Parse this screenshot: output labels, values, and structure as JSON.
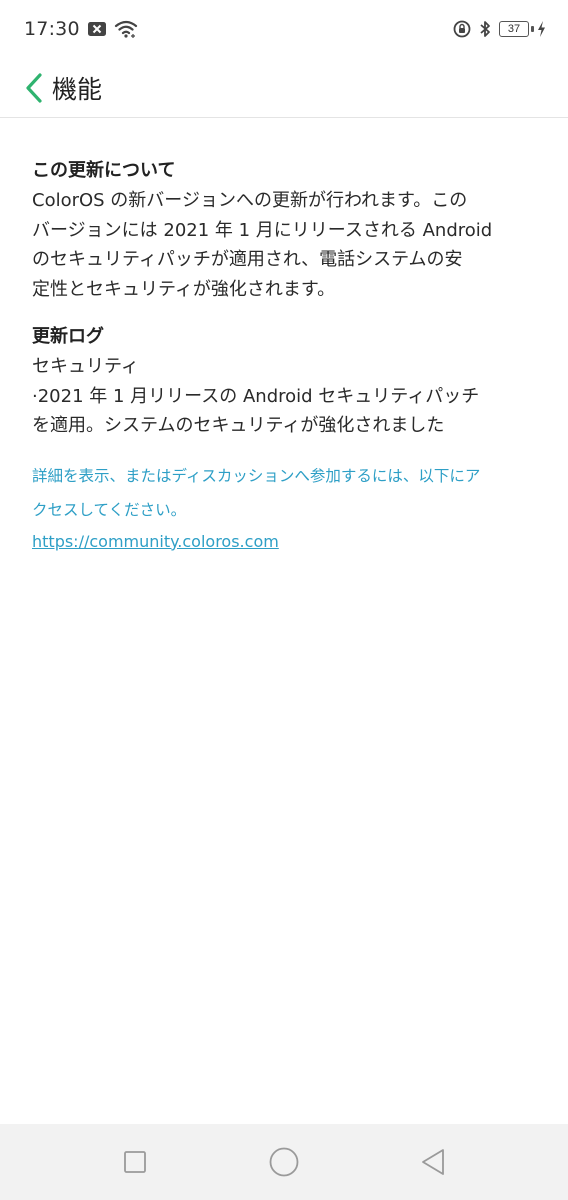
{
  "status_bar": {
    "time": "17:30",
    "battery_level": "37",
    "icons_left": [
      "notification-x-icon",
      "wifi-icon"
    ],
    "icons_right": [
      "rotation-lock-icon",
      "bluetooth-icon",
      "battery-icon",
      "charging-icon"
    ]
  },
  "header": {
    "title": "機能",
    "back_icon": "chevron-left-icon",
    "accent_color": "#2fb36f"
  },
  "about": {
    "title": "この更新について",
    "lines": [
      "ColorOS の新バージョンへの更新が行われます。この",
      "バージョンには 2021 年 1 月にリリースされる Android",
      "のセキュリティパッチが適用され、電話システムの安",
      "定性とセキュリティが強化されます。"
    ]
  },
  "changelog": {
    "title": "更新ログ",
    "lines": [
      "セキュリティ",
      "·2021 年 1 月リリースの Android セキュリティパッチ",
      "を適用。システムのセキュリティが強化されました"
    ]
  },
  "more_info": {
    "lines": [
      "詳細を表示、またはディスカッションへ参加するには、以下にア",
      "クセスしてください。"
    ],
    "link": "https://community.coloros.com",
    "link_color": "#2e9fc6"
  },
  "nav_bar": {
    "buttons": [
      "recents-square-icon",
      "home-circle-icon",
      "back-triangle-icon"
    ]
  }
}
